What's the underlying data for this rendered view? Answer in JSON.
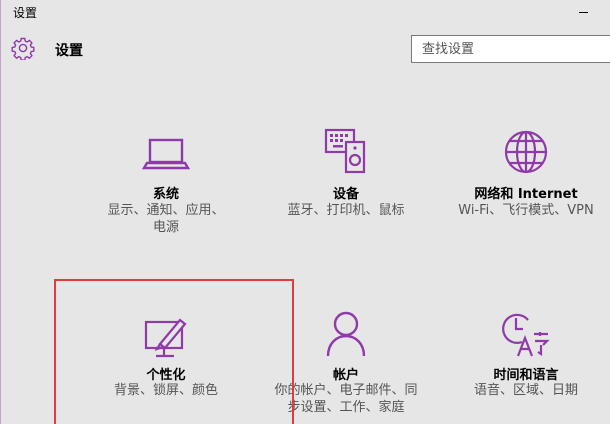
{
  "window": {
    "title": "设置"
  },
  "header": {
    "title": "设置",
    "icon": "gear-icon"
  },
  "search": {
    "placeholder": "查找设置"
  },
  "accent": "#8e3aa8",
  "tiles": [
    {
      "name": "系统",
      "desc": "显示、通知、应用、电源",
      "icon": "laptop-icon"
    },
    {
      "name": "设备",
      "desc": "蓝牙、打印机、鼠标",
      "icon": "devices-icon"
    },
    {
      "name": "网络和 Internet",
      "desc": "Wi-Fi、飞行模式、VPN",
      "icon": "globe-icon"
    },
    {
      "name": "个性化",
      "desc": "背景、锁屏、颜色",
      "icon": "personalization-icon"
    },
    {
      "name": "帐户",
      "desc": "你的帐户、电子邮件、同步设置、工作、家庭",
      "icon": "person-icon"
    },
    {
      "name": "时间和语言",
      "desc": "语音、区域、日期",
      "icon": "time-language-icon"
    }
  ]
}
